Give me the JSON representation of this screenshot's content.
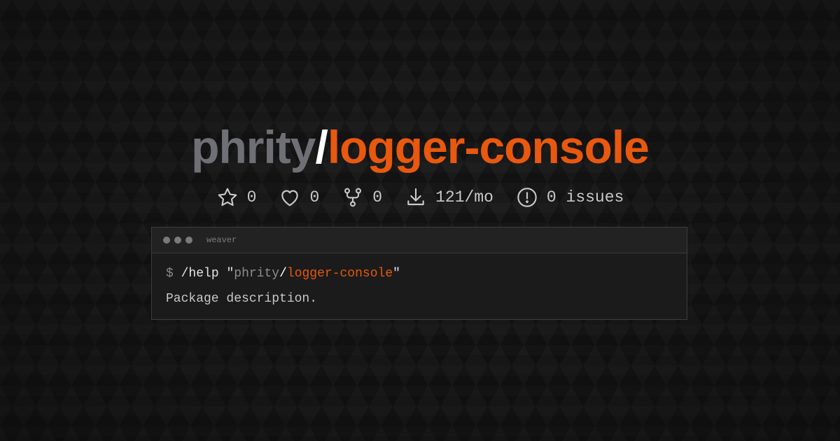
{
  "title": {
    "vendor": "phrity",
    "separator": "/",
    "package": "logger-console"
  },
  "stats": [
    {
      "icon": "star-icon",
      "value": "0"
    },
    {
      "icon": "heart-icon",
      "value": "0"
    },
    {
      "icon": "fork-icon",
      "value": "0"
    },
    {
      "icon": "download-icon",
      "value": "121/mo"
    },
    {
      "icon": "alert-circle-icon",
      "value": "0 issues"
    }
  ],
  "terminal": {
    "title": "weaver",
    "prompt": "$",
    "command": "/help",
    "quote_open": "\"",
    "arg_vendor": "phrity",
    "arg_separator": "/",
    "arg_package": "logger-console",
    "quote_close": "\"",
    "output": "Package description."
  },
  "colors": {
    "background": "#161616",
    "vendor": "#6f6f76",
    "accent": "#e8580f",
    "stats_text": "#c9c9c9"
  }
}
